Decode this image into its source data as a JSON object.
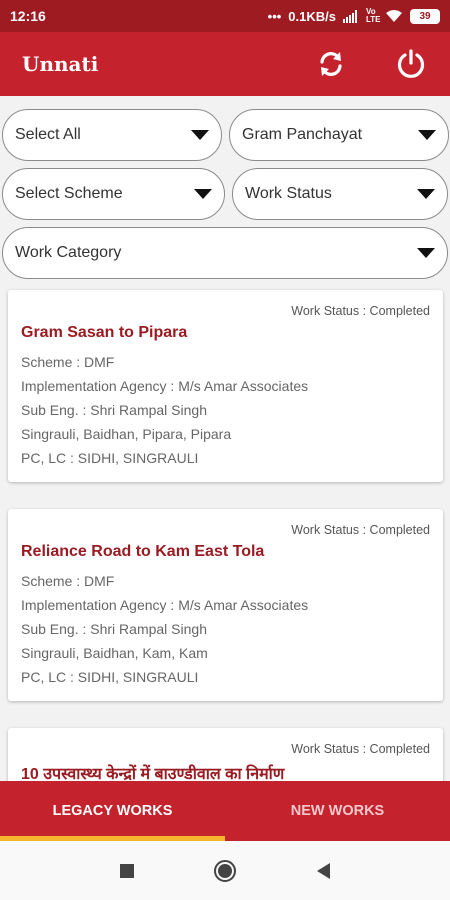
{
  "status_bar": {
    "time": "12:16",
    "network_speed": "0.1KB/s",
    "network_type": "Vo LTE",
    "battery": "39"
  },
  "app": {
    "title": "Unnati",
    "refresh_icon": "refresh-icon",
    "power_icon": "power-icon"
  },
  "filters": {
    "select_all": "Select All",
    "gram_panchayat": "Gram Panchayat",
    "scheme": "Select Scheme",
    "work_status": "Work Status",
    "work_category": "Work Category"
  },
  "works": [
    {
      "status": "Work Status : Completed",
      "title": "Gram Sasan to Pipara",
      "scheme": "Scheme : DMF",
      "agency": "Implementation Agency : M/s Amar Associates",
      "sub_eng": "Sub Eng. : Shri Rampal Singh",
      "location": "Singrauli, Baidhan, Pipara, Pipara",
      "pc_lc": "PC, LC : SIDHI, SINGRAULI"
    },
    {
      "status": "Work Status : Completed",
      "title": "Reliance Road to Kam East Tola",
      "scheme": "Scheme : DMF",
      "agency": "Implementation Agency : M/s Amar Associates",
      "sub_eng": "Sub Eng. : Shri Rampal Singh",
      "location": "Singrauli, Baidhan, Kam, Kam",
      "pc_lc": "PC, LC : SIDHI, SINGRAULI"
    },
    {
      "status": "Work Status : Completed",
      "title": "10 उपस्वास्थ्य केन्द्रों में बाउण्डीवाल का निर्माण"
    }
  ],
  "tabs": {
    "legacy": "LEGACY WORKS",
    "new": "NEW WORKS"
  },
  "colors": {
    "primary": "#c4222d",
    "status_bar": "#9e1b22",
    "title_text": "#9a1b22",
    "tab_indicator": "#f6b52e"
  }
}
